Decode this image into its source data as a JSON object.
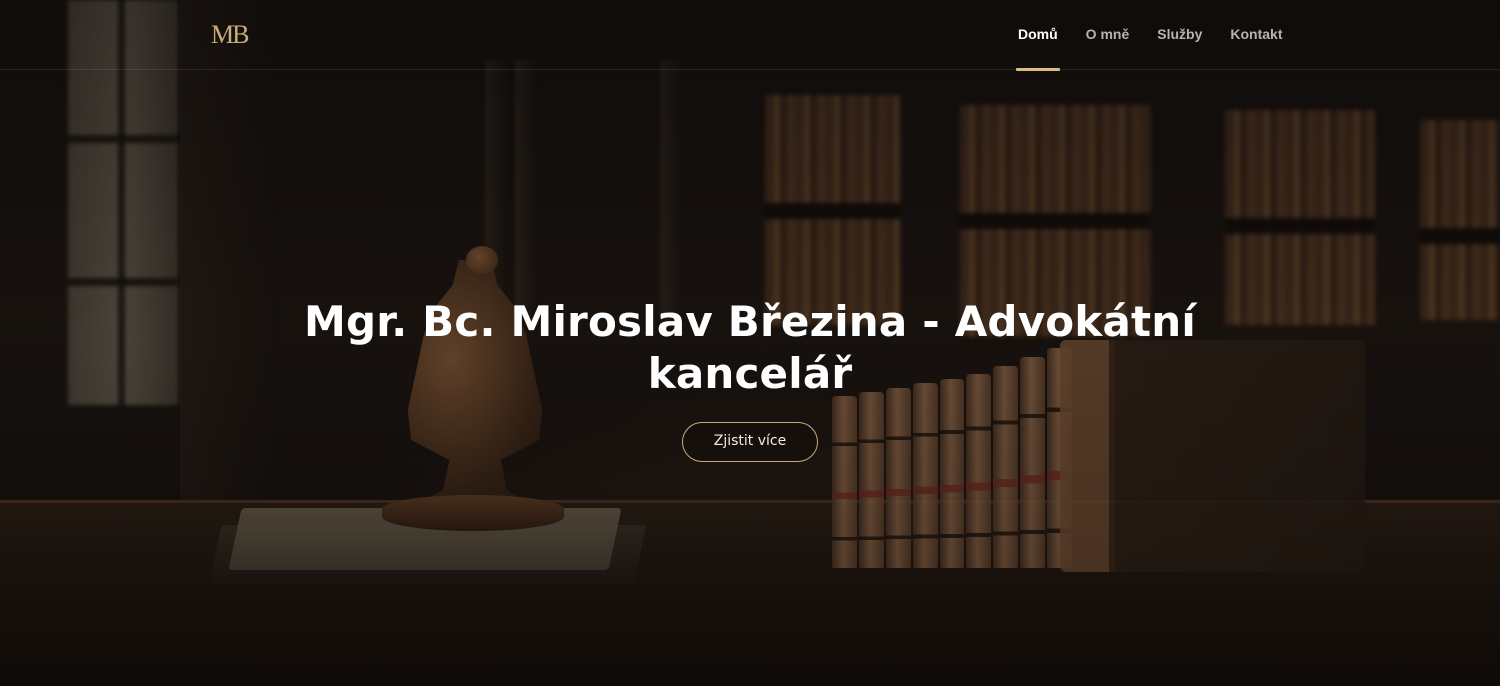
{
  "header": {
    "logo_text": "MB",
    "nav": [
      {
        "label": "Domů",
        "active": true
      },
      {
        "label": "O mně",
        "active": false
      },
      {
        "label": "Služby",
        "active": false
      },
      {
        "label": "Kontakt",
        "active": false
      }
    ]
  },
  "hero": {
    "title_line1": "Mgr. Bc. Miroslav Březina - Advokátní",
    "title_line2": "kancelář",
    "cta_label": "Zjistit více",
    "background_image": "law-office-gavel-books"
  },
  "colors": {
    "accent": "#d9bd88",
    "logo": "#c8ad78",
    "nav_inactive": "#b9b3ac",
    "nav_active": "#ffffff"
  }
}
